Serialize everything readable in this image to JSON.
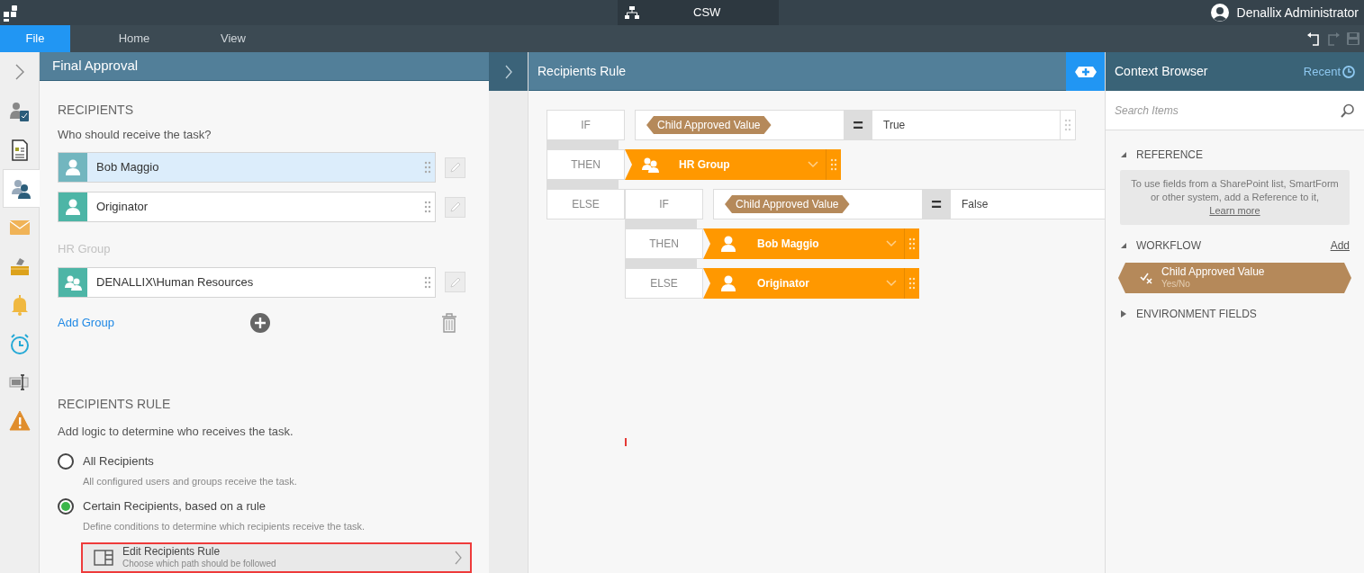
{
  "app": {
    "title": "CSW",
    "user": "Denallix Administrator"
  },
  "menu": [
    {
      "label": "File",
      "selected": true
    },
    {
      "label": "Home",
      "selected": false
    },
    {
      "label": "View",
      "selected": false
    }
  ],
  "rail": [
    {
      "kind": "task",
      "selected": false
    },
    {
      "kind": "form",
      "selected": false
    },
    {
      "kind": "recipients",
      "selected": true
    },
    {
      "kind": "email",
      "selected": false
    },
    {
      "kind": "outbox",
      "selected": false
    },
    {
      "kind": "bell",
      "selected": false
    },
    {
      "kind": "timer",
      "selected": false
    },
    {
      "kind": "field",
      "selected": false
    },
    {
      "kind": "warning",
      "selected": false
    }
  ],
  "left_panel": {
    "title": "Final Approval",
    "recipients_heading": "RECIPIENTS",
    "recipients_prompt": "Who should receive the task?",
    "recipients": [
      {
        "kind": "user",
        "name": "Bob Maggio",
        "selected": true
      },
      {
        "kind": "user",
        "name": "Originator",
        "selected": false
      }
    ],
    "group_heading": "HR Group",
    "group_members": [
      {
        "kind": "group",
        "name": "DENALLIX\\Human Resources",
        "selected": false
      }
    ],
    "add_group": "Add Group",
    "rule_heading": "RECIPIENTS RULE",
    "rule_prompt": "Add logic to determine who receives the task.",
    "options": [
      {
        "label": "All Recipients",
        "description": "All configured users and groups receive the task.",
        "selected": false
      },
      {
        "label": "Certain Recipients, based on a rule",
        "description": "Define conditions to determine which recipients receive the task.",
        "selected": true
      }
    ],
    "edit_button": {
      "title": "Edit Recipients Rule",
      "subtitle": "Choose which path should be followed",
      "highlighted": true
    }
  },
  "rule_panel": {
    "title": "Recipients Rule",
    "rule": {
      "if_label": "IF",
      "field": "Child Approved Value",
      "operator": "=",
      "value": "True",
      "then_label": "THEN",
      "then": {
        "kind": "group",
        "name": "HR Group"
      },
      "else_label": "ELSE",
      "else": {
        "kind": "rule",
        "if_label": "IF",
        "field": "Child Approved Value",
        "operator": "=",
        "value": "False",
        "then_label": "THEN",
        "then": {
          "kind": "user",
          "name": "Bob Maggio"
        },
        "else_label": "ELSE",
        "else": {
          "kind": "user",
          "name": "Originator"
        }
      }
    }
  },
  "context_browser": {
    "title": "Context Browser",
    "recent": "Recent",
    "search": {
      "placeholder": "Search Items"
    },
    "sections": [
      {
        "title": "REFERENCE",
        "expanded": true,
        "info": "To use fields from a SharePoint list, SmartForm or other system, add a Reference to it,",
        "link": "Learn more"
      },
      {
        "title": "WORKFLOW",
        "expanded": true,
        "action": "Add",
        "items": [
          {
            "name": "Child Approved Value",
            "type": "Yes/No"
          }
        ]
      },
      {
        "title": "ENVIRONMENT FIELDS",
        "expanded": false
      }
    ]
  }
}
